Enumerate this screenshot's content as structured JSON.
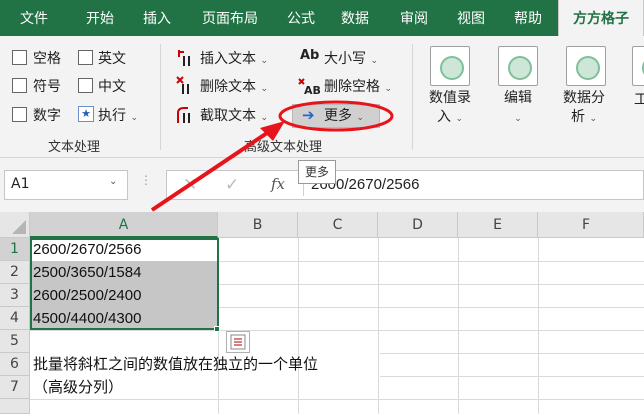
{
  "menu": {
    "tabs": [
      "文件",
      "开始",
      "插入",
      "页面布局",
      "公式",
      "数据",
      "审阅",
      "视图",
      "帮助",
      "方方格子"
    ],
    "active_tab": "方方格子"
  },
  "ribbon": {
    "text_group": {
      "label": "文本处理",
      "options": [
        "空格",
        "英文",
        "符号",
        "中文",
        "数字"
      ],
      "exec_label": "执行"
    },
    "advanced_group": {
      "label": "高级文本处理",
      "buttons": [
        "插入文本",
        "删除文本",
        "截取文本",
        "大小写",
        "删除空格",
        "更多"
      ]
    },
    "big_buttons": [
      {
        "label": "数值录入",
        "icon": "number-entry-icon"
      },
      {
        "label": "编辑",
        "icon": "edit-icon"
      },
      {
        "label": "数据分析",
        "icon": "data-analysis-icon"
      },
      {
        "label": "工",
        "icon": "tools-icon"
      }
    ]
  },
  "tooltip": {
    "text": "更多"
  },
  "formula_bar": {
    "name_box": "A1",
    "fx": "fx",
    "formula": "2600/2670/2566"
  },
  "sheet": {
    "columns": [
      "A",
      "B",
      "C",
      "D",
      "E",
      "F"
    ],
    "rows": [
      "1",
      "2",
      "3",
      "4",
      "5",
      "6",
      "7"
    ],
    "cells": [
      "2600/2670/2566",
      "2500/3650/1584",
      "2600/2500/2400",
      "4500/4400/4300",
      "",
      "批量将斜杠之间的数值放在独立的一个单位",
      "（高级分列）"
    ]
  },
  "colors": {
    "accent": "#217346",
    "annotation": "#e8141b",
    "selection": "#c6c6c6"
  }
}
